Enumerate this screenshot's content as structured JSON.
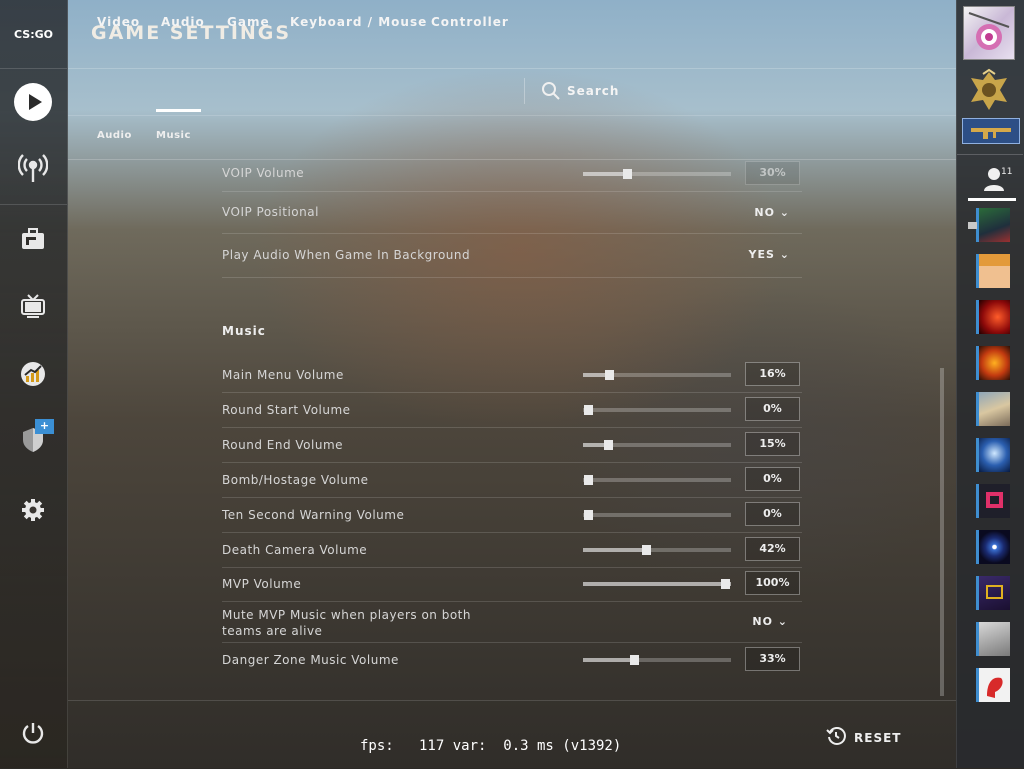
{
  "app": {
    "logo_text": "CS:GO",
    "title": "GAME SETTINGS"
  },
  "tabs": [
    {
      "label": "Video",
      "active": false
    },
    {
      "label": "Audio",
      "active": true
    },
    {
      "label": "Game",
      "active": false
    },
    {
      "label": "Keyboard / Mouse",
      "active": false
    },
    {
      "label": "Controller",
      "active": false
    }
  ],
  "search": {
    "label": "Search"
  },
  "subtabs": [
    {
      "label": "Audio"
    },
    {
      "label": "Music"
    }
  ],
  "nav": {
    "icons": [
      "play-icon",
      "broadcast-icon",
      "briefcase-icon",
      "tv-icon",
      "stats-icon",
      "shield-icon",
      "gear-icon",
      "power-icon"
    ],
    "shield_badge": "+"
  },
  "friends": {
    "count": "11"
  },
  "settings": {
    "voip_volume": {
      "label": "VOIP Volume",
      "value": "30%",
      "level": 0.3
    },
    "voip_positional": {
      "label": "VOIP Positional",
      "value": "NO"
    },
    "play_audio_bg": {
      "label": "Play Audio When Game In Background",
      "value": "YES"
    },
    "music_header": "Music",
    "main_menu": {
      "label": "Main Menu Volume",
      "value": "16%",
      "level": 0.16
    },
    "round_start": {
      "label": "Round Start Volume",
      "value": "0%",
      "level": 0.0
    },
    "round_end": {
      "label": "Round End Volume",
      "value": "15%",
      "level": 0.15
    },
    "bomb_hostage": {
      "label": "Bomb/Hostage Volume",
      "value": "0%",
      "level": 0.0
    },
    "ten_second": {
      "label": "Ten Second Warning Volume",
      "value": "0%",
      "level": 0.0
    },
    "death_camera": {
      "label": "Death Camera Volume",
      "value": "42%",
      "level": 0.42
    },
    "mvp": {
      "label": "MVP Volume",
      "value": "100%",
      "level": 1.0
    },
    "mute_mvp": {
      "label_line1": "Mute MVP Music when players on both",
      "label_line2": "teams are alive",
      "value": "NO"
    },
    "danger_zone": {
      "label": "Danger Zone Music Volume",
      "value": "33%",
      "level": 0.33
    }
  },
  "footer": {
    "fps_text": "fps:   117 var:  0.3 ms (v1392)",
    "reset_label": "RESET"
  },
  "colors": {
    "accent_underline": "#ffffff",
    "badge": "#3b8fd4",
    "friend_border": "#3f8ed0"
  }
}
